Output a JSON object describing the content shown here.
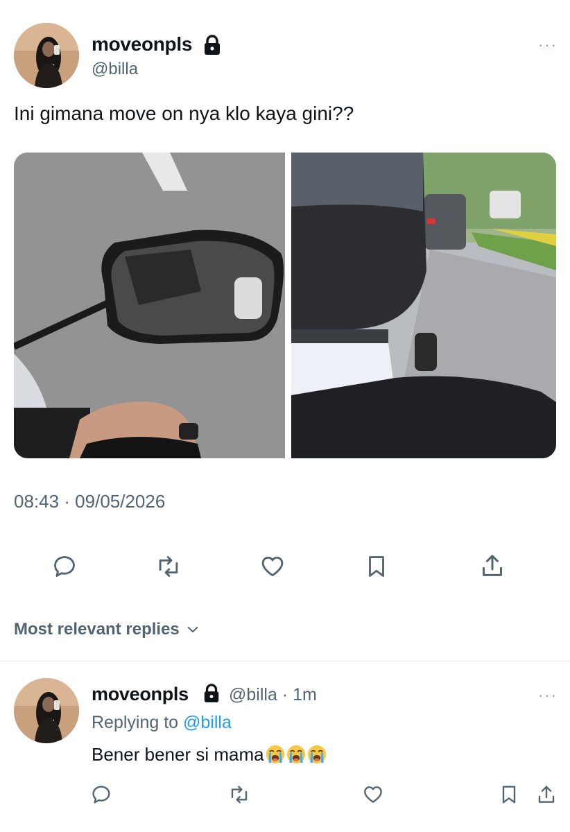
{
  "tweet": {
    "author_name": "moveonpls",
    "author_handle": "@billa",
    "text": "Ini gimana move on nya klo kaya gini??",
    "timestamp": "08:43 · 09/05/2026",
    "more_glyph": "···",
    "icons": {
      "reply": "reply-icon",
      "retweet": "retweet-icon",
      "like": "heart-icon",
      "bookmark": "bookmark-icon",
      "share": "share-icon",
      "lock": "lock-icon"
    }
  },
  "replies": {
    "filter_label": "Most relevant replies"
  },
  "reply": {
    "author_name": "moveonpls",
    "meta": "@billa · 1m",
    "replying_prefix": "Replying to",
    "replying_handle": "@billa",
    "text": "Bener bener si mama",
    "emoji_count": 3,
    "emoji_name": "loudly-crying-face"
  },
  "colors": {
    "text": "#0f1419",
    "secondary": "#536471",
    "accent": "#1d9bf0",
    "divider": "#e6ecf0"
  }
}
